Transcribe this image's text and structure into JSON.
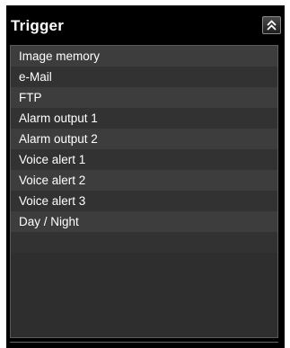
{
  "panel": {
    "title": "Trigger",
    "collapse_icon": "double-chevron-up-icon"
  },
  "trigger_list": {
    "items": [
      {
        "label": "Image memory"
      },
      {
        "label": "e-Mail"
      },
      {
        "label": "FTP"
      },
      {
        "label": "Alarm output 1"
      },
      {
        "label": "Alarm output 2"
      },
      {
        "label": "Voice alert 1"
      },
      {
        "label": "Voice alert 2"
      },
      {
        "label": "Voice alert 3"
      },
      {
        "label": "Day / Night"
      }
    ]
  },
  "colors": {
    "panel_background": "#000000",
    "list_row_odd": "#3d3d3d",
    "list_row_even": "#323232",
    "text": "#ffffff"
  }
}
